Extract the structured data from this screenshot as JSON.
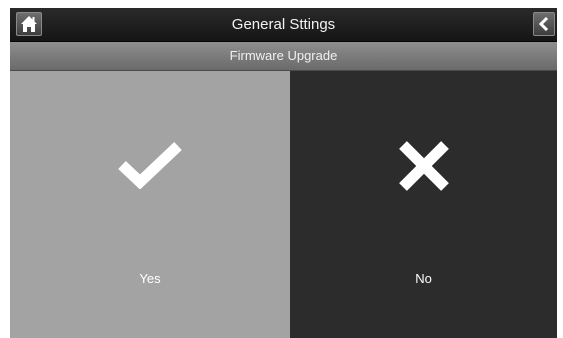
{
  "header": {
    "title": "General Sttings",
    "home_icon": "home-icon",
    "back_icon": "back-arrow-icon"
  },
  "subheader": {
    "title": "Firmware Upgrade"
  },
  "options": {
    "yes": {
      "label": "Yes",
      "icon": "checkmark-icon",
      "bg_color": "#a3a3a3"
    },
    "no": {
      "label": "No",
      "icon": "cross-icon",
      "bg_color": "#2c2c2c"
    }
  }
}
